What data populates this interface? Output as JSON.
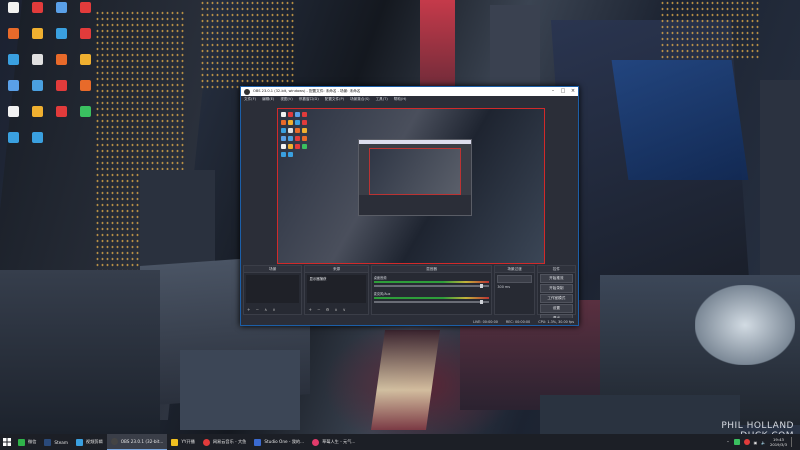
{
  "desktop": {
    "watermark_line1": "PHIL HOLLAND",
    "watermark_line2": "DUCK COM",
    "icons": [
      {
        "label": "",
        "color": "#f2f2f2"
      },
      {
        "label": "",
        "color": "#e23b3b"
      },
      {
        "label": "",
        "color": "#5aa0e8"
      },
      {
        "label": "",
        "color": "#e23b3b"
      },
      {
        "label": "",
        "color": "#e86a2a"
      },
      {
        "label": "",
        "color": "#f0b030"
      },
      {
        "label": "",
        "color": "#3aa0e0"
      },
      {
        "label": "",
        "color": "#e23b3b"
      },
      {
        "label": "",
        "color": "#3aa0e0"
      },
      {
        "label": "",
        "color": "#e0e0e0"
      },
      {
        "label": "",
        "color": "#e86a2a"
      },
      {
        "label": "",
        "color": "#f0b030"
      },
      {
        "label": "",
        "color": "#5aa0e8"
      },
      {
        "label": "",
        "color": "#4aa0e0"
      },
      {
        "label": "",
        "color": "#e23b3b"
      },
      {
        "label": "",
        "color": "#e86a2a"
      },
      {
        "label": "",
        "color": "#f2f2f2"
      },
      {
        "label": "",
        "color": "#f0b030"
      },
      {
        "label": "",
        "color": "#e23b3b"
      },
      {
        "label": "",
        "color": "#3ac060"
      },
      {
        "label": "",
        "color": "#3aa0e0"
      },
      {
        "label": "",
        "color": "#3aa0e0"
      }
    ]
  },
  "obs": {
    "title": "OBS 23.0.1 (32-bit, windows) - 配置文件: 未命名 - 场景: 未命名",
    "menu": [
      "文件(F)",
      "编辑(E)",
      "视图(V)",
      "停靠窗口(D)",
      "配置文件(P)",
      "场景集合(S)",
      "工具(T)",
      "帮助(H)"
    ],
    "panels": {
      "scenes": "场景",
      "sources": "来源",
      "mixer": "混音器",
      "transitions": "场景过渡",
      "controls": "控件"
    },
    "source_item": "显示器捕获",
    "mixer_tracks": [
      "桌面音频",
      "麦克风/Aux"
    ],
    "transition_duration": "300 ms",
    "controls": [
      "开始推流",
      "开始录制",
      "工作室模式",
      "设置",
      "退出"
    ],
    "status": [
      "LIVE: 00:00:00",
      "REC: 00:00:00",
      "CPU: 1.3%, 30.00 fps"
    ]
  },
  "taskbar": {
    "items": [
      {
        "label": "微信",
        "color": "#2fb34a"
      },
      {
        "label": "Steam",
        "color": "#2a4a7a"
      },
      {
        "label": "视频剪辑",
        "color": "#3aa0e0"
      },
      {
        "label": "OBS 23.0.1 (32-bit...",
        "color": "#444"
      },
      {
        "label": "YY开播",
        "color": "#f0c020"
      },
      {
        "label": "网易云音乐 - 大鱼",
        "color": "#e23b3b"
      },
      {
        "label": "Studio One - 我的...",
        "color": "#3a6ad0"
      },
      {
        "label": "草莓人生 - 元气...",
        "color": "#e23b6b"
      }
    ],
    "time": "19:43",
    "date": "2019/3/3"
  }
}
